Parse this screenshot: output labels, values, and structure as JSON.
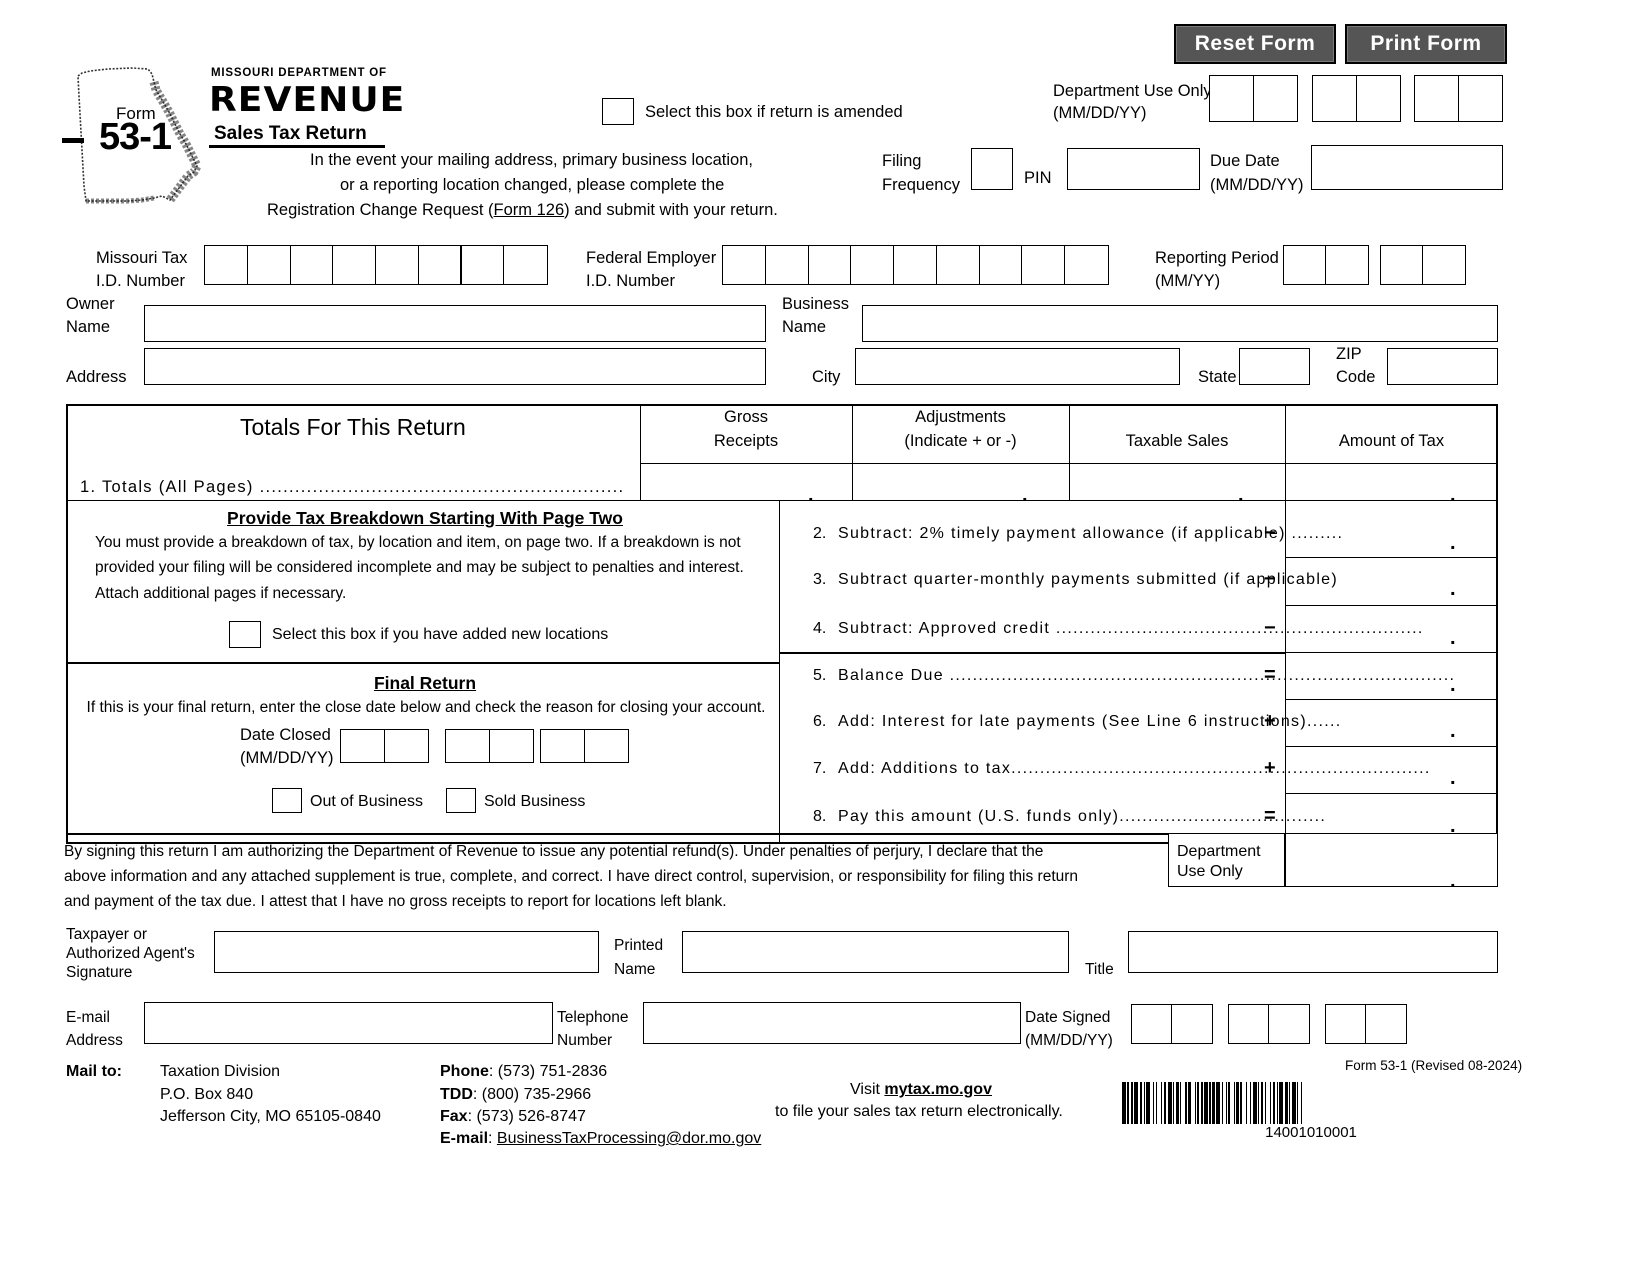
{
  "buttons": {
    "reset": "Reset Form",
    "print": "Print Form"
  },
  "header": {
    "form_word": "Form",
    "form_number": "53-1",
    "agency_small": "MISSOURI DEPARTMENT OF",
    "agency_large": "REVENUE",
    "form_title": "Sales Tax Return",
    "amended_checkbox_label": "Select this box if return is amended",
    "instruction_line1": "In the event your mailing address, primary business location,",
    "instruction_line2": "or a reporting location changed, please complete the",
    "instruction_line3_a": "Registration Change Request (",
    "instruction_line3_link": "Form 126",
    "instruction_line3_b": ") and submit with your return.",
    "dept_use_only": "Department Use Only",
    "dept_use_only_fmt": "(MM/DD/YY)",
    "filing_frequency_l1": "Filing",
    "filing_frequency_l2": "Frequency",
    "pin": "PIN",
    "due_date_l1": "Due Date",
    "due_date_l2": "(MM/DD/YY)"
  },
  "identity": {
    "mo_tax_id_l1": "Missouri Tax",
    "mo_tax_id_l2": "I.D. Number",
    "fed_id_l1": "Federal Employer",
    "fed_id_l2": "I.D. Number",
    "reporting_period_l1": "Reporting Period",
    "reporting_period_l2": "(MM/YY)",
    "owner_name_l1": "Owner",
    "owner_name_l2": "Name",
    "business_name_l1": "Business",
    "business_name_l2": "Name",
    "address": "Address",
    "city": "City",
    "state": "State",
    "zip_l1": "ZIP",
    "zip_l2": "Code"
  },
  "totals": {
    "title": "Totals For This Return",
    "col_gross_l1": "Gross",
    "col_gross_l2": "Receipts",
    "col_adj_l1": "Adjustments",
    "col_adj_l2": "(Indicate + or -)",
    "col_taxable": "Taxable Sales",
    "col_tax": "Amount of Tax",
    "line1": "1.  Totals (All Pages) .............................................................."
  },
  "breakdown": {
    "heading": "Provide Tax Breakdown Starting With Page Two",
    "p1": "You must provide a breakdown of tax, by location and item, on page two.  If a breakdown is not",
    "p2": "provided your filing will be considered incomplete and may be subject to penalties and interest.",
    "p3": "Attach additional pages if necessary.",
    "new_locations_label": "Select this box if you have added new locations"
  },
  "final_return": {
    "heading": "Final Return",
    "instruction": "If this is your final return, enter the close date below and check the reason for closing your account.",
    "date_closed_l1": "Date Closed",
    "date_closed_l2": "(MM/DD/YY)",
    "out_of_business": "Out of Business",
    "sold_business": "Sold Business"
  },
  "lines": [
    {
      "n": "2.",
      "text": "Subtract: 2% timely payment allowance (if applicable) .........",
      "op": "−"
    },
    {
      "n": "3.",
      "text": "Subtract quarter-monthly payments submitted (if applicable)",
      "op": "−"
    },
    {
      "n": "4.",
      "text": "Subtract: Approved credit ................................................................",
      "op": "−"
    },
    {
      "n": "5.",
      "text": "Balance Due ........................................................................................",
      "op": "="
    },
    {
      "n": "6.",
      "text": "Add: Interest for late payments (See Line 6 instructions)......",
      "op": "+"
    },
    {
      "n": "7.",
      "text": "Add: Additions to tax.........................................................................",
      "op": "+"
    },
    {
      "n": "8.",
      "text": "Pay this amount (U.S. funds only)....................................",
      "op": "="
    }
  ],
  "perjury": {
    "l1": "By signing this return I am authorizing the Department of Revenue to issue any potential refund(s).  Under penalties of perjury, I declare that the",
    "l2": "above information and any attached supplement is true, complete, and correct.  I have direct control, supervision, or responsibility for filing this return",
    "l3": " and payment of the tax due.  I attest that I have no gross receipts to report for locations left blank.",
    "dept_use_l1": "Department",
    "dept_use_l2": "Use Only"
  },
  "signature": {
    "sig_l1": "Taxpayer or",
    "sig_l2": "Authorized Agent's",
    "sig_l3": "Signature",
    "printed_l1": "Printed",
    "printed_l2": "Name",
    "title": "Title",
    "email_l1": "E-mail",
    "email_l2": "Address",
    "phone_l1": "Telephone",
    "phone_l2": "Number",
    "date_signed_l1": "Date Signed",
    "date_signed_l2": "(MM/DD/YY)"
  },
  "footer": {
    "mail_to": "Mail to:",
    "addr1": "Taxation Division",
    "addr2": "P.O. Box 840",
    "addr3": "Jefferson City, MO 65105-0840",
    "phone_label": "Phone",
    "phone_value": ": (573) 751-2836",
    "tdd_label": "TDD",
    "tdd_value": ": (800) 735-2966",
    "fax_label": "Fax",
    "fax_value": ": (573) 526-8747",
    "email_label": "E-mail",
    "email_value": "BusinessTaxProcessing@dor.mo.gov",
    "visit_prefix": "Visit ",
    "visit_link": "mytax.mo.gov",
    "visit_suffix": "to file your sales tax return electronically.",
    "revision": "Form 53-1 (Revised 08-2024)",
    "barcode_number": "14001010001"
  }
}
